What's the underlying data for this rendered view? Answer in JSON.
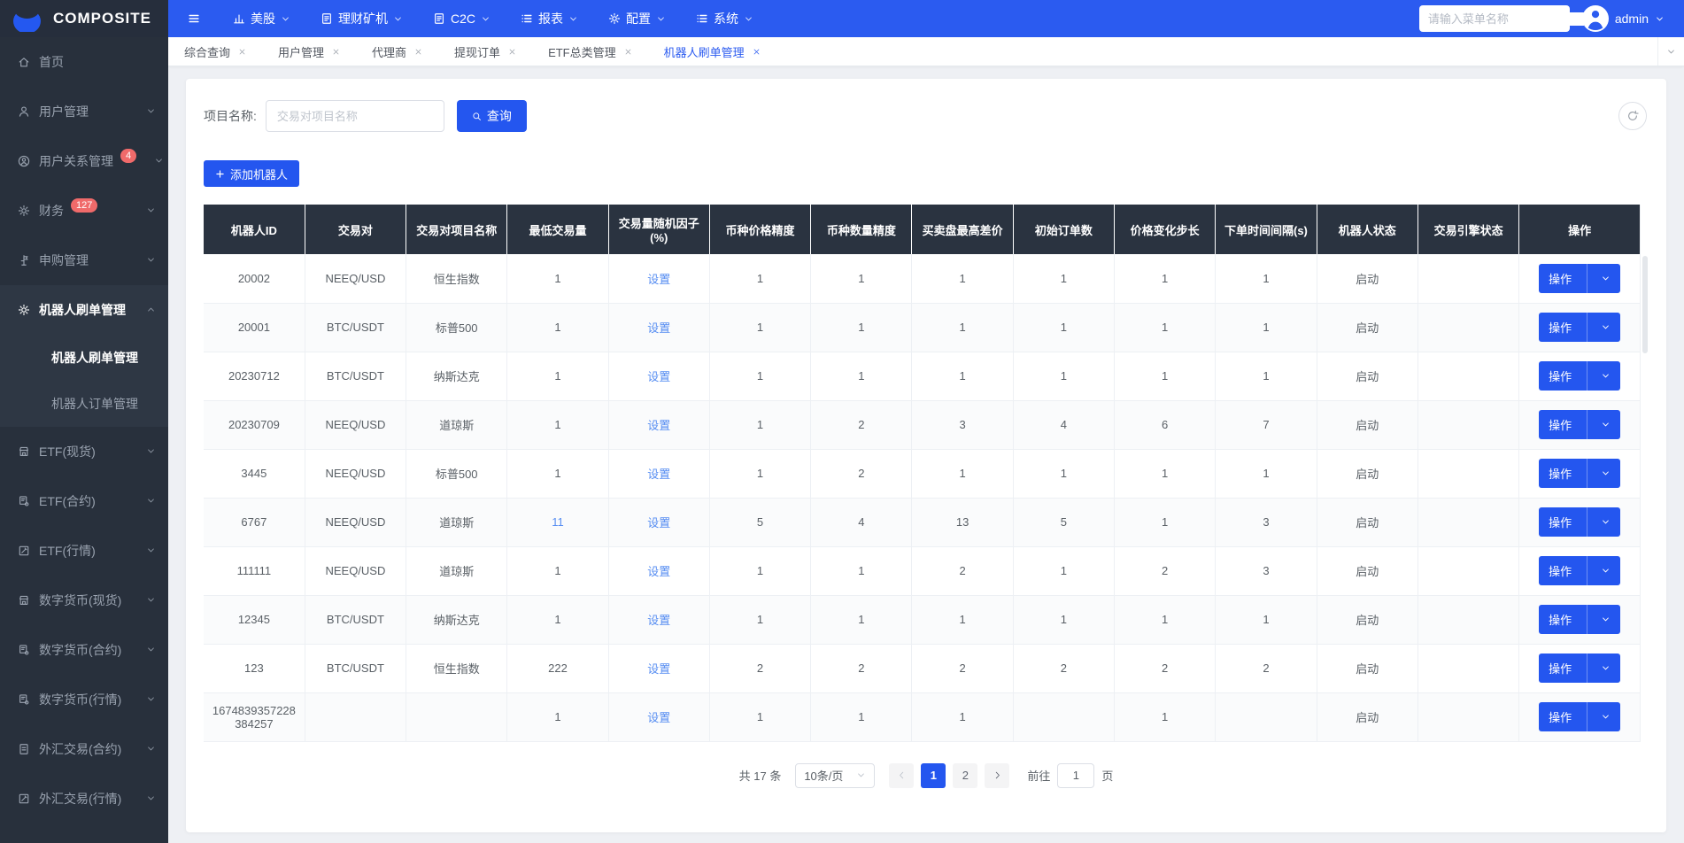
{
  "colors": {
    "accent": "#2b5bf0",
    "button_blue": "#2456ef",
    "badge_red": "#f06a6a",
    "table_header_bg": "#2a3340",
    "sidebar_bg": "#28303c",
    "link_blue": "#568df2"
  },
  "topbar": {
    "brand": "COMPOSITE",
    "menus": [
      {
        "icon": "chart",
        "label": "美股"
      },
      {
        "icon": "doc",
        "label": "理财矿机"
      },
      {
        "icon": "doc",
        "label": "C2C"
      },
      {
        "icon": "list",
        "label": "报表"
      },
      {
        "icon": "gear",
        "label": "配置"
      },
      {
        "icon": "list",
        "label": "系统"
      }
    ],
    "search_placeholder": "请输入菜单名称",
    "user": "admin"
  },
  "sidebar": {
    "items": [
      {
        "icon": "home",
        "label": "首页"
      },
      {
        "icon": "user",
        "label": "用户管理",
        "arrow": "down"
      },
      {
        "icon": "user-circle",
        "label": "用户关系管理",
        "badge": "4",
        "arrow": "down"
      },
      {
        "icon": "gear",
        "label": "财务",
        "badge": "127",
        "arrow": "down"
      },
      {
        "icon": "signpost",
        "label": "申购管理",
        "arrow": "down"
      },
      {
        "icon": "gear",
        "label": "机器人刷单管理",
        "arrow": "up",
        "expanded": true,
        "children": [
          {
            "label": "机器人刷单管理",
            "active": true
          },
          {
            "label": "机器人订单管理"
          }
        ]
      },
      {
        "icon": "shop",
        "label": "ETF(现货)",
        "arrow": "down"
      },
      {
        "icon": "doc-gear",
        "label": "ETF(合约)",
        "arrow": "down"
      },
      {
        "icon": "edit",
        "label": "ETF(行情)",
        "arrow": "down"
      },
      {
        "icon": "shop",
        "label": "数字货币(现货)",
        "arrow": "down"
      },
      {
        "icon": "doc-gear",
        "label": "数字货币(合约)",
        "arrow": "down"
      },
      {
        "icon": "doc-gear",
        "label": "数字货币(行情)",
        "arrow": "down"
      },
      {
        "icon": "file",
        "label": "外汇交易(合约)",
        "arrow": "down"
      },
      {
        "icon": "edit",
        "label": "外汇交易(行情)",
        "arrow": "down"
      }
    ]
  },
  "tabs": {
    "items": [
      {
        "label": "综合查询"
      },
      {
        "label": "用户管理"
      },
      {
        "label": "代理商"
      },
      {
        "label": "提现订单"
      },
      {
        "label": "ETF总类管理"
      },
      {
        "label": "机器人刷单管理",
        "active": true
      }
    ]
  },
  "toolbar": {
    "filter_label": "项目名称:",
    "filter_placeholder": "交易对项目名称",
    "search_label": "查询",
    "add_label": "添加机器人"
  },
  "table": {
    "headers": [
      "机器人ID",
      "交易对",
      "交易对项目名称",
      "最低交易量",
      "交易量随机因子(%)",
      "币种价格精度",
      "币种数量精度",
      "买卖盘最高差价",
      "初始订单数",
      "价格变化步长",
      "下单时间间隔(s)",
      "机器人状态",
      "交易引擎状态",
      "操作"
    ],
    "settings_label": "设置",
    "action_label": "操作",
    "blue_min_row_ids": [
      "6767"
    ],
    "rows": [
      [
        "20002",
        "NEEQ/USD",
        "恒生指数",
        "1",
        "1",
        "1",
        "1",
        "1",
        "1",
        "1",
        "启动",
        ""
      ],
      [
        "20001",
        "BTC/USDT",
        "标普500",
        "1",
        "1",
        "1",
        "1",
        "1",
        "1",
        "1",
        "启动",
        ""
      ],
      [
        "20230712",
        "BTC/USDT",
        "纳斯达克",
        "1",
        "1",
        "1",
        "1",
        "1",
        "1",
        "1",
        "启动",
        ""
      ],
      [
        "20230709",
        "NEEQ/USD",
        "道琼斯",
        "1",
        "1",
        "2",
        "3",
        "4",
        "6",
        "7",
        "启动",
        ""
      ],
      [
        "3445",
        "NEEQ/USD",
        "标普500",
        "1",
        "1",
        "2",
        "1",
        "1",
        "1",
        "1",
        "启动",
        ""
      ],
      [
        "6767",
        "NEEQ/USD",
        "道琼斯",
        "11",
        "5",
        "4",
        "13",
        "5",
        "1",
        "3",
        "启动",
        ""
      ],
      [
        "111111",
        "NEEQ/USD",
        "道琼斯",
        "1",
        "1",
        "1",
        "2",
        "1",
        "2",
        "3",
        "启动",
        ""
      ],
      [
        "12345",
        "BTC/USDT",
        "纳斯达克",
        "1",
        "1",
        "1",
        "1",
        "1",
        "1",
        "1",
        "启动",
        ""
      ],
      [
        "123",
        "BTC/USDT",
        "恒生指数",
        "222",
        "2",
        "2",
        "2",
        "2",
        "2",
        "2",
        "启动",
        ""
      ],
      [
        "1674839357228384257",
        "",
        "",
        "1",
        "1",
        "1",
        "1",
        "",
        "1",
        "",
        "启动",
        ""
      ]
    ]
  },
  "pagination": {
    "total": "共 17 条",
    "page_size": "10条/页",
    "pages": [
      "1",
      "2"
    ],
    "active": "1",
    "goto_label": "前往",
    "goto_value": "1",
    "goto_unit": "页"
  }
}
